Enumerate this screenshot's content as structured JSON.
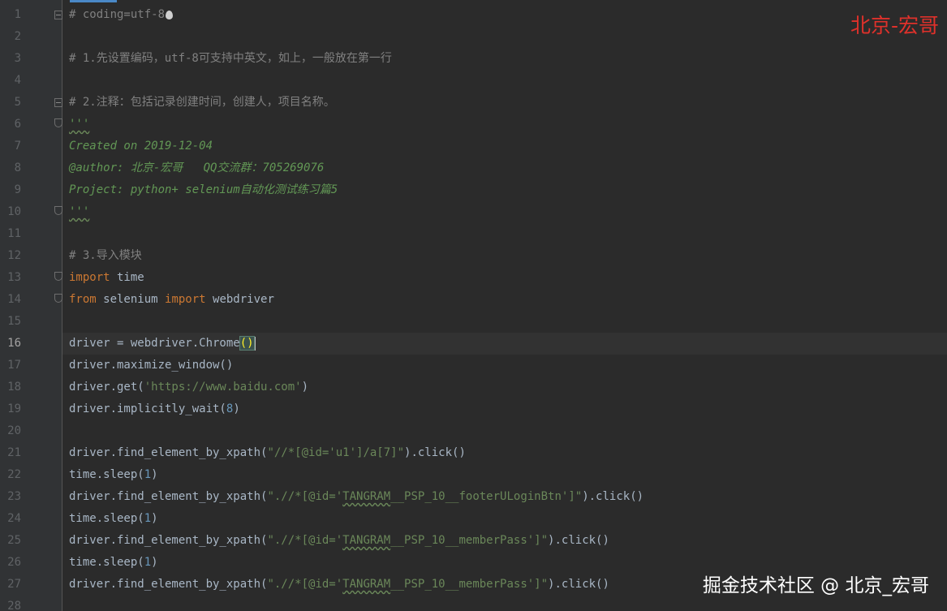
{
  "watermarks": {
    "top": "北京-宏哥",
    "bottom": "掘金技术社区 @ 北京_宏哥"
  },
  "gutter": {
    "line_numbers": [
      "1",
      "2",
      "3",
      "4",
      "5",
      "6",
      "7",
      "8",
      "9",
      "10",
      "11",
      "12",
      "13",
      "14",
      "15",
      "16",
      "17",
      "18",
      "19",
      "20",
      "21",
      "22",
      "23",
      "24",
      "25",
      "26",
      "27",
      "28"
    ],
    "current_line": "16"
  },
  "code": {
    "l1": "# coding=utf-8",
    "l3": "# 1.先设置编码，utf-8可支持中英文，如上，一般放在第一行",
    "l5": "# 2.注释：包括记录创建时间，创建人，项目名称。",
    "l6": "'''",
    "l7": "Created on 2019-12-04",
    "l8": "@author: 北京-宏哥   QQ交流群：705269076",
    "l9": "Project: python+ selenium自动化测试练习篇5",
    "l10": "'''",
    "l12": "# 3.导入模块",
    "l13_kw": "import",
    "l13_rest": " time",
    "l14_kw1": "from",
    "l14_mid": " selenium ",
    "l14_kw2": "import",
    "l14_rest": " webdriver",
    "l16_a": "driver = webdriver.Chrome",
    "l16_paren": "()",
    "l17": "driver.maximize_window()",
    "l18_a": "driver.get(",
    "l18_str": "'https://www.baidu.com'",
    "l18_b": ")",
    "l19_a": "driver.implicitly_wait(",
    "l19_num": "8",
    "l19_b": ")",
    "l21_a": "driver.find_element_by_xpath(",
    "l21_str": "\"//*[@id='u1']/a[7]\"",
    "l21_b": ").click()",
    "l22_a": "time.sleep(",
    "l22_num": "1",
    "l22_b": ")",
    "l23_a": "driver.find_element_by_xpath(",
    "l23_str1": "\".//*[@id='",
    "l23_sq": "TANGRAM",
    "l23_str2": "__PSP_10__footerULoginBtn']\"",
    "l23_b": ").click()",
    "l24_a": "time.sleep(",
    "l24_num": "1",
    "l24_b": ")",
    "l25_a": "driver.find_element_by_xpath(",
    "l25_str1": "\".//*[@id='",
    "l25_sq": "TANGRAM",
    "l25_str2": "__PSP_10__memberPass']\"",
    "l25_b": ").click()",
    "l26_a": "time.sleep(",
    "l26_num": "1",
    "l26_b": ")",
    "l27_a": "driver.find_element_by_xpath(",
    "l27_str1": "\".//*[@id='",
    "l27_sq": "TANGRAM",
    "l27_str2": "__PSP_10__memberPass']\"",
    "l27_b": ").click()"
  },
  "colors": {
    "background": "#2b2b2b",
    "gutter": "#313335",
    "comment": "#808080",
    "docstring": "#629755",
    "keyword": "#cc7832",
    "string": "#6a8759",
    "number": "#6897bb",
    "text": "#a9b7c6",
    "watermark_red": "#e0312b"
  },
  "icons": {
    "line1_marker": "drop-icon",
    "fold_markers": "fold-icon"
  }
}
